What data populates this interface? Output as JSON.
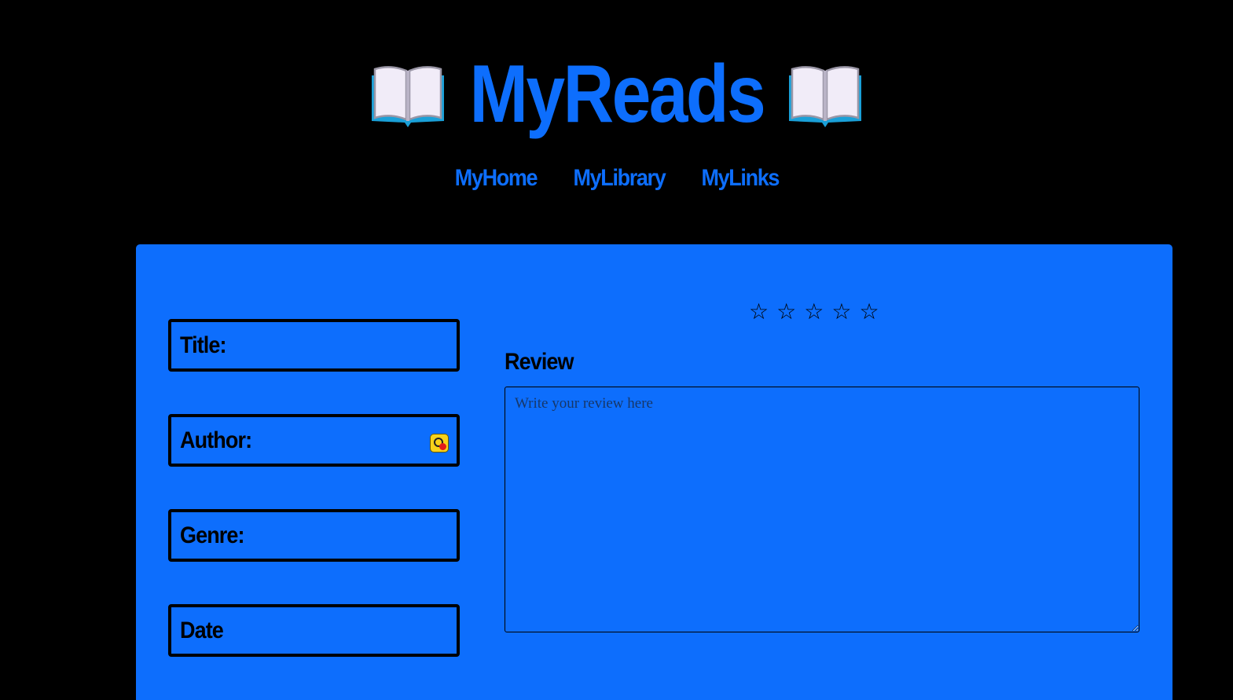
{
  "site": {
    "title": "MyReads",
    "left_icon": "open-book-icon",
    "right_icon": "open-book-icon"
  },
  "nav": {
    "items": [
      "MyHome",
      "MyLibrary",
      "MyLinks"
    ]
  },
  "form": {
    "title_label": "Title:",
    "author_label": "Author:",
    "genre_label": "Genre:",
    "date_label": "Date",
    "author_extension_icon": "extension-icon"
  },
  "rating": {
    "stars": [
      "☆",
      "☆",
      "☆",
      "☆",
      "☆"
    ],
    "value": 0,
    "max": 5
  },
  "review": {
    "label": "Review",
    "placeholder": "Write your review here",
    "value": ""
  },
  "colors": {
    "background": "#000000",
    "accent": "#0d6efd",
    "text": "#000000"
  }
}
